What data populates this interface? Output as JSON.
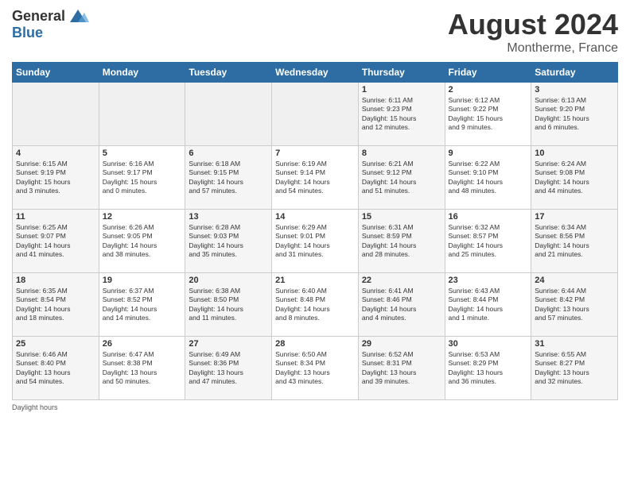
{
  "header": {
    "logo_general": "General",
    "logo_blue": "Blue",
    "month_year": "August 2024",
    "location": "Montherme, France"
  },
  "days_of_week": [
    "Sunday",
    "Monday",
    "Tuesday",
    "Wednesday",
    "Thursday",
    "Friday",
    "Saturday"
  ],
  "weeks": [
    [
      {
        "day": "",
        "info": ""
      },
      {
        "day": "",
        "info": ""
      },
      {
        "day": "",
        "info": ""
      },
      {
        "day": "",
        "info": ""
      },
      {
        "day": "1",
        "info": "Sunrise: 6:11 AM\nSunset: 9:23 PM\nDaylight: 15 hours\nand 12 minutes."
      },
      {
        "day": "2",
        "info": "Sunrise: 6:12 AM\nSunset: 9:22 PM\nDaylight: 15 hours\nand 9 minutes."
      },
      {
        "day": "3",
        "info": "Sunrise: 6:13 AM\nSunset: 9:20 PM\nDaylight: 15 hours\nand 6 minutes."
      }
    ],
    [
      {
        "day": "4",
        "info": "Sunrise: 6:15 AM\nSunset: 9:19 PM\nDaylight: 15 hours\nand 3 minutes."
      },
      {
        "day": "5",
        "info": "Sunrise: 6:16 AM\nSunset: 9:17 PM\nDaylight: 15 hours\nand 0 minutes."
      },
      {
        "day": "6",
        "info": "Sunrise: 6:18 AM\nSunset: 9:15 PM\nDaylight: 14 hours\nand 57 minutes."
      },
      {
        "day": "7",
        "info": "Sunrise: 6:19 AM\nSunset: 9:14 PM\nDaylight: 14 hours\nand 54 minutes."
      },
      {
        "day": "8",
        "info": "Sunrise: 6:21 AM\nSunset: 9:12 PM\nDaylight: 14 hours\nand 51 minutes."
      },
      {
        "day": "9",
        "info": "Sunrise: 6:22 AM\nSunset: 9:10 PM\nDaylight: 14 hours\nand 48 minutes."
      },
      {
        "day": "10",
        "info": "Sunrise: 6:24 AM\nSunset: 9:08 PM\nDaylight: 14 hours\nand 44 minutes."
      }
    ],
    [
      {
        "day": "11",
        "info": "Sunrise: 6:25 AM\nSunset: 9:07 PM\nDaylight: 14 hours\nand 41 minutes."
      },
      {
        "day": "12",
        "info": "Sunrise: 6:26 AM\nSunset: 9:05 PM\nDaylight: 14 hours\nand 38 minutes."
      },
      {
        "day": "13",
        "info": "Sunrise: 6:28 AM\nSunset: 9:03 PM\nDaylight: 14 hours\nand 35 minutes."
      },
      {
        "day": "14",
        "info": "Sunrise: 6:29 AM\nSunset: 9:01 PM\nDaylight: 14 hours\nand 31 minutes."
      },
      {
        "day": "15",
        "info": "Sunrise: 6:31 AM\nSunset: 8:59 PM\nDaylight: 14 hours\nand 28 minutes."
      },
      {
        "day": "16",
        "info": "Sunrise: 6:32 AM\nSunset: 8:57 PM\nDaylight: 14 hours\nand 25 minutes."
      },
      {
        "day": "17",
        "info": "Sunrise: 6:34 AM\nSunset: 8:56 PM\nDaylight: 14 hours\nand 21 minutes."
      }
    ],
    [
      {
        "day": "18",
        "info": "Sunrise: 6:35 AM\nSunset: 8:54 PM\nDaylight: 14 hours\nand 18 minutes."
      },
      {
        "day": "19",
        "info": "Sunrise: 6:37 AM\nSunset: 8:52 PM\nDaylight: 14 hours\nand 14 minutes."
      },
      {
        "day": "20",
        "info": "Sunrise: 6:38 AM\nSunset: 8:50 PM\nDaylight: 14 hours\nand 11 minutes."
      },
      {
        "day": "21",
        "info": "Sunrise: 6:40 AM\nSunset: 8:48 PM\nDaylight: 14 hours\nand 8 minutes."
      },
      {
        "day": "22",
        "info": "Sunrise: 6:41 AM\nSunset: 8:46 PM\nDaylight: 14 hours\nand 4 minutes."
      },
      {
        "day": "23",
        "info": "Sunrise: 6:43 AM\nSunset: 8:44 PM\nDaylight: 14 hours\nand 1 minute."
      },
      {
        "day": "24",
        "info": "Sunrise: 6:44 AM\nSunset: 8:42 PM\nDaylight: 13 hours\nand 57 minutes."
      }
    ],
    [
      {
        "day": "25",
        "info": "Sunrise: 6:46 AM\nSunset: 8:40 PM\nDaylight: 13 hours\nand 54 minutes."
      },
      {
        "day": "26",
        "info": "Sunrise: 6:47 AM\nSunset: 8:38 PM\nDaylight: 13 hours\nand 50 minutes."
      },
      {
        "day": "27",
        "info": "Sunrise: 6:49 AM\nSunset: 8:36 PM\nDaylight: 13 hours\nand 47 minutes."
      },
      {
        "day": "28",
        "info": "Sunrise: 6:50 AM\nSunset: 8:34 PM\nDaylight: 13 hours\nand 43 minutes."
      },
      {
        "day": "29",
        "info": "Sunrise: 6:52 AM\nSunset: 8:31 PM\nDaylight: 13 hours\nand 39 minutes."
      },
      {
        "day": "30",
        "info": "Sunrise: 6:53 AM\nSunset: 8:29 PM\nDaylight: 13 hours\nand 36 minutes."
      },
      {
        "day": "31",
        "info": "Sunrise: 6:55 AM\nSunset: 8:27 PM\nDaylight: 13 hours\nand 32 minutes."
      }
    ]
  ],
  "footer": {
    "daylight_label": "Daylight hours"
  }
}
